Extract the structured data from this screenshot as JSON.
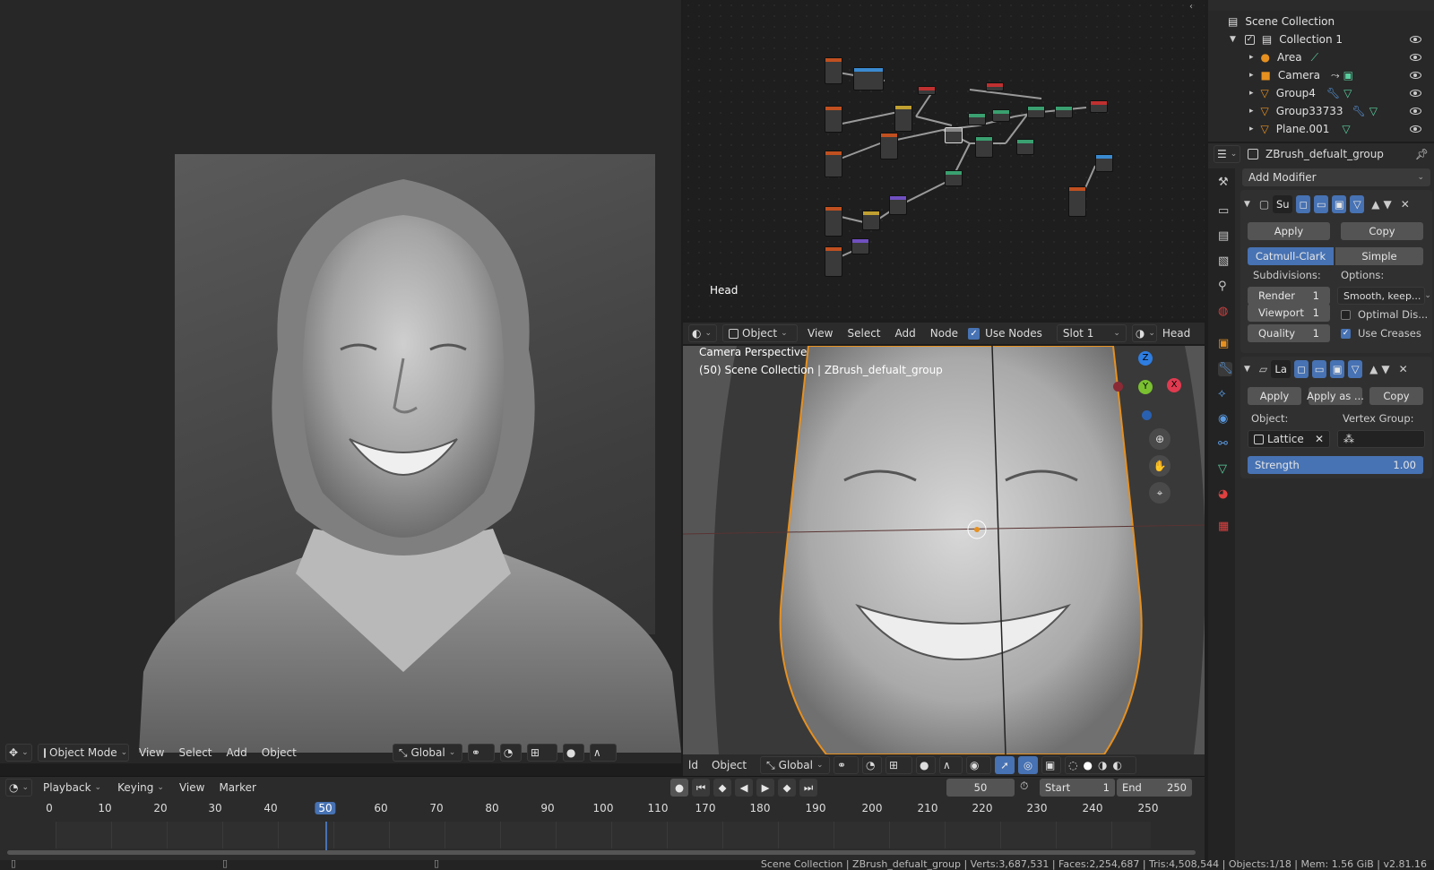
{
  "colors": {
    "accent": "#4772b3",
    "selected_outline": "#e6901e",
    "node_bg": "#1d1d1d"
  },
  "left_viewport": {
    "mode": "Object Mode",
    "menus": [
      "View",
      "Select",
      "Add",
      "Object"
    ],
    "orientation": "Global"
  },
  "node_editor": {
    "label": "Head",
    "object": "Object",
    "menus": [
      "View",
      "Select",
      "Add",
      "Node"
    ],
    "use_nodes_label": "Use Nodes",
    "slot": "Slot 1",
    "material": "Head"
  },
  "camera_viewport": {
    "line1": "Camera Perspective",
    "line2": "(50) Scene Collection | ZBrush_defualt_group",
    "header_left": "ld",
    "object_menu": "Object",
    "orientation": "Global",
    "gizmo": {
      "x": "X",
      "y": "Y",
      "z": "Z"
    }
  },
  "timeline": {
    "menus": [
      "Playback",
      "Keying",
      "View",
      "Marker"
    ],
    "current_frame": "50",
    "start_label": "Start",
    "start": "1",
    "end_label": "End",
    "end": "250",
    "ticks": [
      "0",
      "10",
      "20",
      "30",
      "40",
      "50",
      "60",
      "70",
      "80",
      "90",
      "100",
      "110",
      "170",
      "180",
      "190",
      "200",
      "210",
      "220",
      "230",
      "240",
      "250"
    ]
  },
  "outliner": {
    "root": "Scene Collection",
    "collection": "Collection 1",
    "items": [
      {
        "name": "Area"
      },
      {
        "name": "Camera"
      },
      {
        "name": "Group4"
      },
      {
        "name": "Group33733"
      },
      {
        "name": "Plane.001"
      }
    ]
  },
  "properties": {
    "object_name": "ZBrush_defualt_group",
    "add_modifier": "Add Modifier",
    "subsurf": {
      "name": "Su",
      "apply": "Apply",
      "copy": "Copy",
      "catmull": "Catmull-Clark",
      "simple": "Simple",
      "subdivisions_label": "Subdivisions:",
      "options_label": "Options:",
      "render_label": "Render",
      "render_val": "1",
      "viewport_label": "Viewport",
      "viewport_val": "1",
      "quality_label": "Quality",
      "quality_val": "1",
      "smooth": "Smooth, keep...",
      "optimal": "Optimal Dis...",
      "use_creases": "Use Creases"
    },
    "lattice": {
      "name": "La",
      "apply": "Apply",
      "apply_as": "Apply as ...",
      "copy": "Copy",
      "object_label": "Object:",
      "vgroup_label": "Vertex Group:",
      "object_val": "Lattice",
      "strength_label": "Strength",
      "strength_val": "1.00"
    }
  },
  "statusbar": {
    "text": "Scene Collection | ZBrush_defualt_group | Verts:3,687,531 | Faces:2,254,687 | Tris:4,508,544 | Objects:1/18 | Mem: 1.56 GiB | v2.81.16"
  }
}
